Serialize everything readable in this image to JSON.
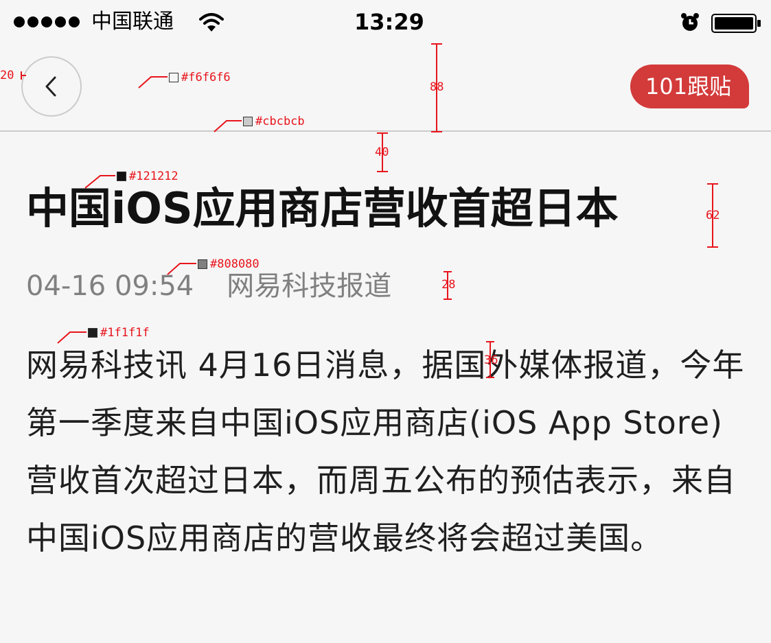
{
  "status_bar": {
    "carrier": "中国联通",
    "time": "13:29",
    "icons": [
      "signal-dots",
      "wifi-icon",
      "alarm-icon",
      "battery-icon"
    ]
  },
  "nav": {
    "back_icon": "chevron-left-icon",
    "reply_label": "101跟贴"
  },
  "article": {
    "title": "中国iOS应用商店营收首超日本",
    "date": "04-16 09:54",
    "source": "网易科技报道",
    "body": "网易科技讯 4月16日消息，据国外媒体报道，今年第一季度来自中国iOS应用商店(iOS App Store) 营收首次超过日本，而周五公布的预估表示，来自中国iOS应用商店的营收最终将会超过美国。"
  },
  "annotations": {
    "bg_color": "#f6f6f6",
    "divider_color": "#cbcbcb",
    "title_color": "#121212",
    "meta_color": "#808080",
    "body_color": "#1f1f1f",
    "accent_color": "#d33a3a",
    "dim_back_margin": "20",
    "dim_nav_height": "88",
    "dim_title_gap": "40",
    "dim_title_size": "62",
    "dim_meta_size": "28",
    "dim_body_size": "36"
  }
}
